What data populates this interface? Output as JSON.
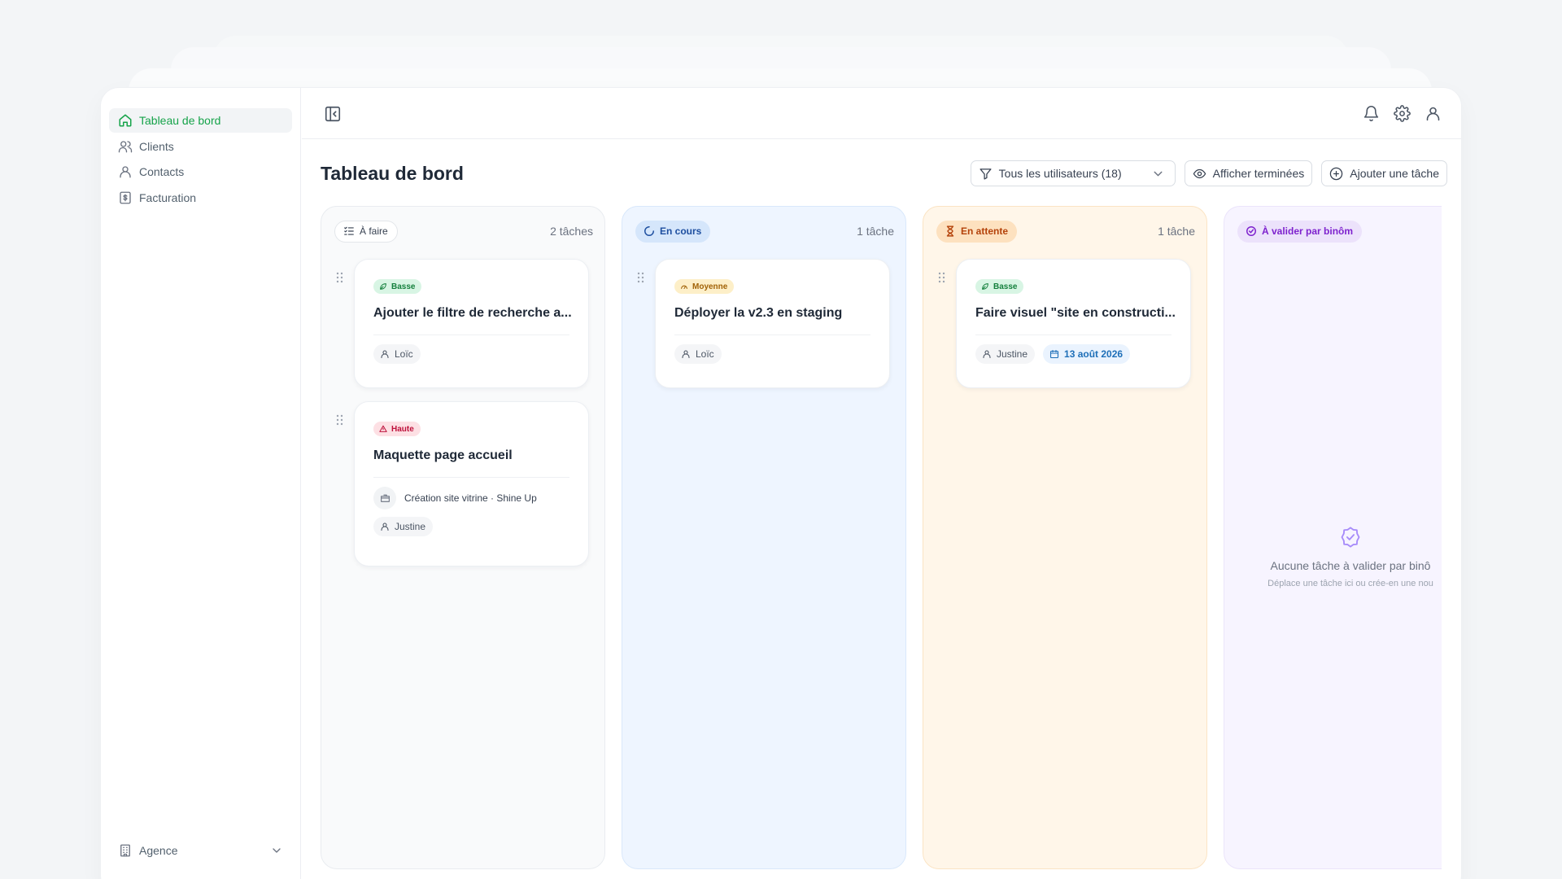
{
  "sidebar": {
    "items": [
      {
        "label": "Tableau de bord",
        "icon": "home-icon",
        "active": true
      },
      {
        "label": "Clients",
        "icon": "users-icon"
      },
      {
        "label": "Contacts",
        "icon": "user-icon"
      },
      {
        "label": "Facturation",
        "icon": "receipt-icon"
      }
    ],
    "workspace": {
      "label": "Agence",
      "icon": "building-icon"
    }
  },
  "topbar": {
    "icons": [
      "sidebar-toggle-icon",
      "bell-icon",
      "gear-icon",
      "user-icon"
    ]
  },
  "page": {
    "title": "Tableau de bord",
    "filter": "Tous les utilisateurs (18)",
    "show_done_label": "Afficher terminées",
    "add_task_label": "Ajouter une tâche"
  },
  "columns": [
    {
      "label": "À faire",
      "count": "2 tâches",
      "color": "#f9fafb",
      "cards": [
        {
          "priority": "Basse",
          "title": "Ajouter le filtre de recherche a...",
          "assignee": "Loïc"
        },
        {
          "priority": "Haute",
          "title": "Maquette page accueil",
          "project": "Création site vitrine · Shine Up",
          "assignee": "Justine"
        }
      ]
    },
    {
      "label": "En cours",
      "count": "1 tâche",
      "color": "#eef5ff",
      "cards": [
        {
          "priority": "Moyenne",
          "title": "Déployer la v2.3 en staging",
          "assignee": "Loïc"
        }
      ]
    },
    {
      "label": "En attente",
      "count": "1 tâche",
      "color": "#fff6e9",
      "cards": [
        {
          "priority": "Basse",
          "title": "Faire visuel \"site en constructi...",
          "assignee": "Justine",
          "due": "13 août 2026"
        }
      ]
    },
    {
      "label": "À valider par binôm",
      "color": "#f7f4ff",
      "empty_title": "Aucune tâche à valider par binô",
      "empty_sub": "Déplace une tâche ici ou crée-en une nou"
    }
  ],
  "colors": {
    "accent": "#16a34a",
    "blue": "#1e4fa0",
    "orange": "#b4420a",
    "purple": "#7e22ce"
  }
}
